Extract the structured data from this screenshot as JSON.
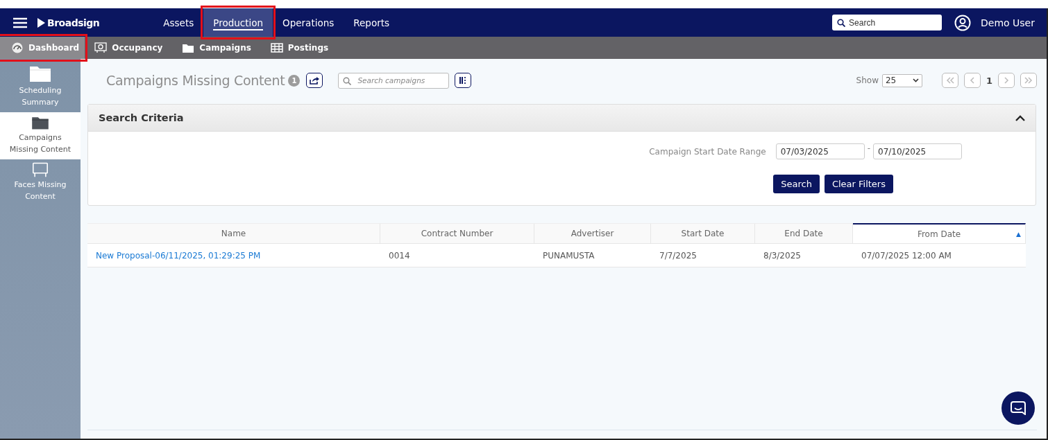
{
  "top_nav": {
    "brand": "Broadsign",
    "items": [
      {
        "label": "Assets",
        "selected": false,
        "highlighted": false
      },
      {
        "label": "Production",
        "selected": true,
        "highlighted": true
      },
      {
        "label": "Operations",
        "selected": false,
        "highlighted": false
      },
      {
        "label": "Reports",
        "selected": false,
        "highlighted": false
      }
    ],
    "search": {
      "placeholder": "Search"
    },
    "user": "Demo User"
  },
  "sub_nav": {
    "items": [
      {
        "label": "Dashboard",
        "kind": "gauge",
        "selected": true,
        "highlighted": true
      },
      {
        "label": "Occupancy",
        "kind": "monitor",
        "selected": false,
        "highlighted": false
      },
      {
        "label": "Campaigns",
        "kind": "folder",
        "selected": false,
        "highlighted": false
      },
      {
        "label": "Postings",
        "kind": "grid",
        "selected": false,
        "highlighted": false
      }
    ]
  },
  "sidebar": {
    "items": [
      {
        "label": "Scheduling Summary",
        "kind": "folder",
        "selected": false
      },
      {
        "label": "Campaigns Missing Content",
        "kind": "folder",
        "selected": true
      },
      {
        "label": "Faces Missing Content",
        "kind": "board",
        "selected": false
      }
    ]
  },
  "page": {
    "title": "Campaigns Missing Content",
    "count": "1",
    "search": {
      "placeholder": "Search campaigns"
    },
    "show_label": "Show",
    "page_size": "25",
    "current_page": "1"
  },
  "search_criteria": {
    "title": "Search Criteria",
    "expanded": true,
    "date_range_label": "Campaign Start Date Range",
    "from": "07/03/2025",
    "separator": "-",
    "to": "07/10/2025",
    "buttons": [
      "Search",
      "Clear Filters"
    ]
  },
  "table": {
    "columns": [
      {
        "label": "Name",
        "sorted": false
      },
      {
        "label": "Contract Number",
        "sorted": false
      },
      {
        "label": "Advertiser",
        "sorted": false
      },
      {
        "label": "Start Date",
        "sorted": false
      },
      {
        "label": "End Date",
        "sorted": false
      },
      {
        "label": "From Date",
        "sorted": true
      }
    ],
    "sort_indicator": "▲",
    "rows": [
      {
        "cells": [
          "New Proposal-06/11/2025, 01:29:25 PM",
          "0014",
          "PUNAMUSTA",
          "7/7/2025",
          "8/3/2025",
          "07/07/2025 12:00 AM"
        ]
      }
    ]
  }
}
